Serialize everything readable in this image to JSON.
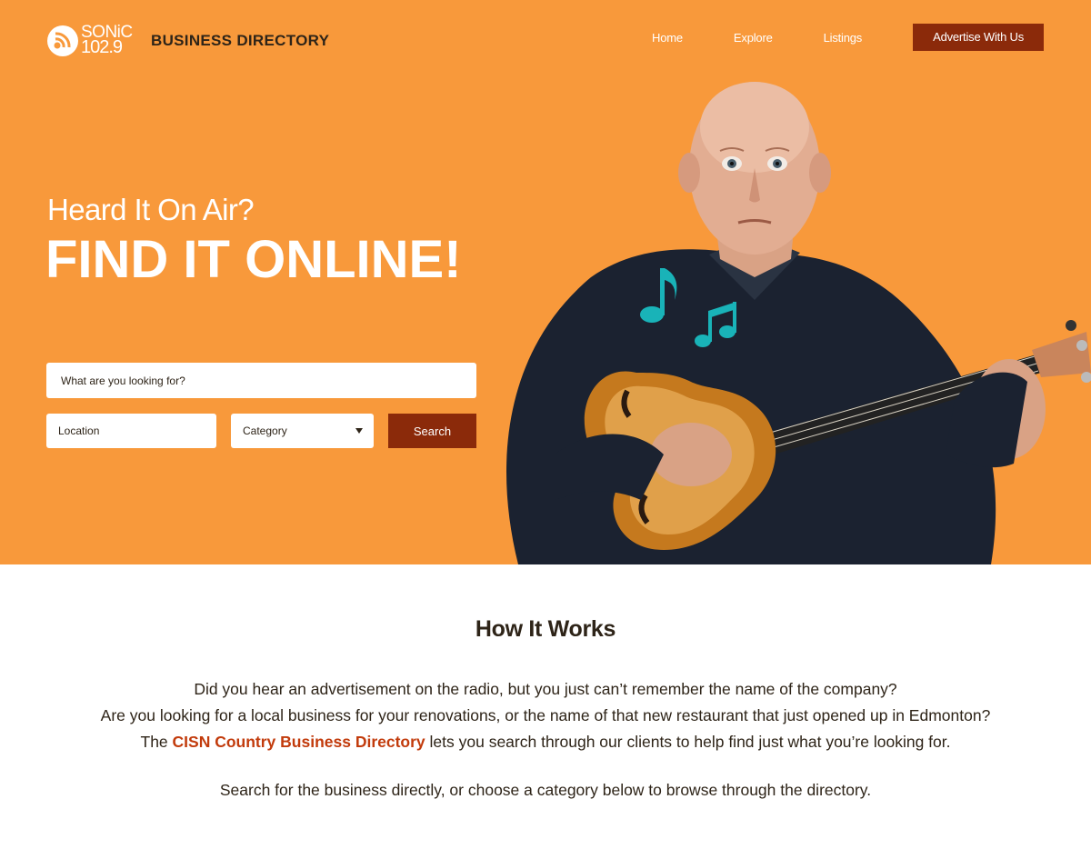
{
  "header": {
    "logo_line1": "SONiC",
    "logo_line2": "102.9",
    "title": "BUSINESS DIRECTORY",
    "nav": [
      {
        "label": "Home"
      },
      {
        "label": "Explore"
      },
      {
        "label": "Listings"
      }
    ],
    "cta_label": "Advertise With Us"
  },
  "hero": {
    "tagline_small": "Heard It On Air?",
    "tagline_big": "FIND IT ONLINE!",
    "search_placeholder": "What are you looking for?",
    "location_placeholder": "Location",
    "category_selected": "Category",
    "search_button": "Search",
    "image": "man-with-ukulele-photo"
  },
  "how_it_works": {
    "title": "How It Works",
    "line1": "Did you hear an advertisement on the radio, but you just can’t remember the name of the company?",
    "line2": "Are you looking for a local business for your renovations, or the name of that new restaurant that just opened up in Edmonton?",
    "line3_pre": "The ",
    "line3_highlight": "CISN Country Business Directory",
    "line3_post": " lets you search through our clients to help find just what you’re looking for.",
    "line4": "Search for the business directly, or choose a category below to browse through the directory."
  },
  "colors": {
    "hero_bg": "#f8993b",
    "accent_dark": "#8b2a0a",
    "highlight": "#c23b0c",
    "text_dark": "#2e2418",
    "note_teal": "#19b3b8"
  }
}
